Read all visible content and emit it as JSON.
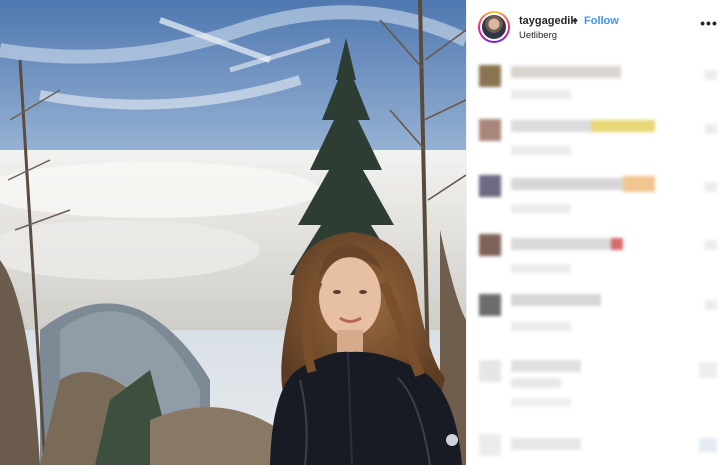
{
  "post": {
    "username": "taygagedik",
    "separator": "•",
    "follow_label": "Follow",
    "location": "Uetliberg",
    "more_label": "•••",
    "image_icon": "photo-of-woman-on-mountain"
  },
  "colors": {
    "follow_blue": "#3897f0",
    "text": "#262626",
    "border": "#efefef"
  },
  "comments": {
    "state": "blurred",
    "count": 7
  }
}
